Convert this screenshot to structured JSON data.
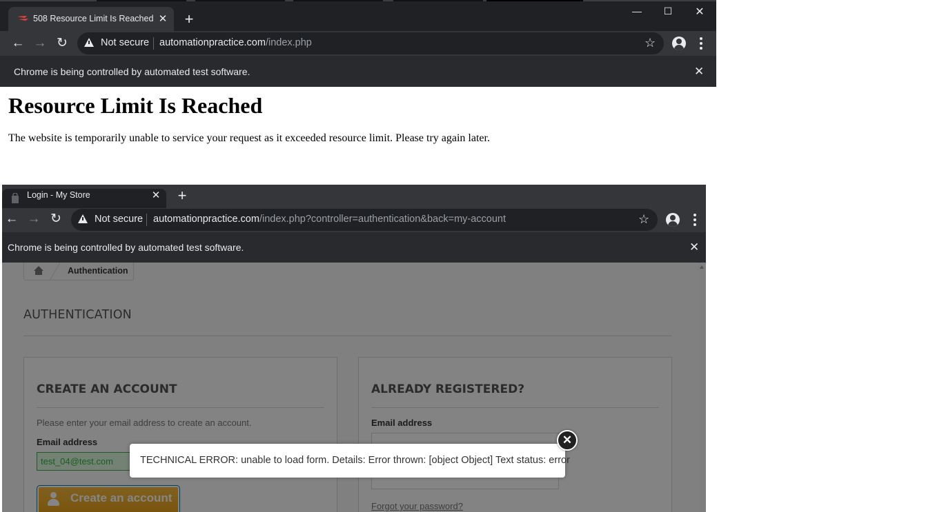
{
  "window1": {
    "tab": {
      "title": "508 Resource Limit Is Reached",
      "close": "✕"
    },
    "new_tab": "+",
    "controls": {
      "minimize": "—",
      "maximize": "☐",
      "close": "✕"
    },
    "toolbar": {
      "back": "←",
      "forward": "→",
      "reload": "↻"
    },
    "omnibox": {
      "security": "Not secure",
      "host": "automationpractice.com",
      "path": "/index.php",
      "star": "☆"
    },
    "infobar": {
      "message": "Chrome is being controlled by automated test software.",
      "close": "✕"
    },
    "page": {
      "heading": "Resource Limit Is Reached",
      "body": "The website is temporarily unable to service your request as it exceeded resource limit. Please try again later."
    }
  },
  "window2": {
    "tab": {
      "title": "Login - My Store",
      "close": "✕"
    },
    "new_tab": "+",
    "toolbar": {
      "back": "←",
      "forward": "→",
      "reload": "↻"
    },
    "omnibox": {
      "security": "Not secure",
      "host": "automationpractice.com",
      "path": "/index.php?controller=authentication&back=my-account",
      "star": "☆"
    },
    "infobar": {
      "message": "Chrome is being controlled by automated test software.",
      "close": "✕"
    },
    "page": {
      "breadcrumb": "Authentication",
      "heading": "AUTHENTICATION",
      "create": {
        "title": "CREATE AN ACCOUNT",
        "hint": "Please enter your email address to create an account.",
        "email_label": "Email address",
        "email_value": "test_04@test.com",
        "button": "Create an account"
      },
      "login": {
        "title": "ALREADY REGISTERED?",
        "email_label": "Email address",
        "email_value": "",
        "forgot": "Forgot your password?"
      }
    },
    "modal": {
      "message": "TECHNICAL ERROR: unable to load form. Details: Error thrown: [object Object] Text status: error",
      "close": "✕"
    }
  },
  "colors": {
    "chrome_dark": "#202124",
    "chrome_toolbar": "#35363a",
    "infobar": "#292a2d",
    "button_orange": "#f0ad2e",
    "valid_green": "#35b33f"
  }
}
